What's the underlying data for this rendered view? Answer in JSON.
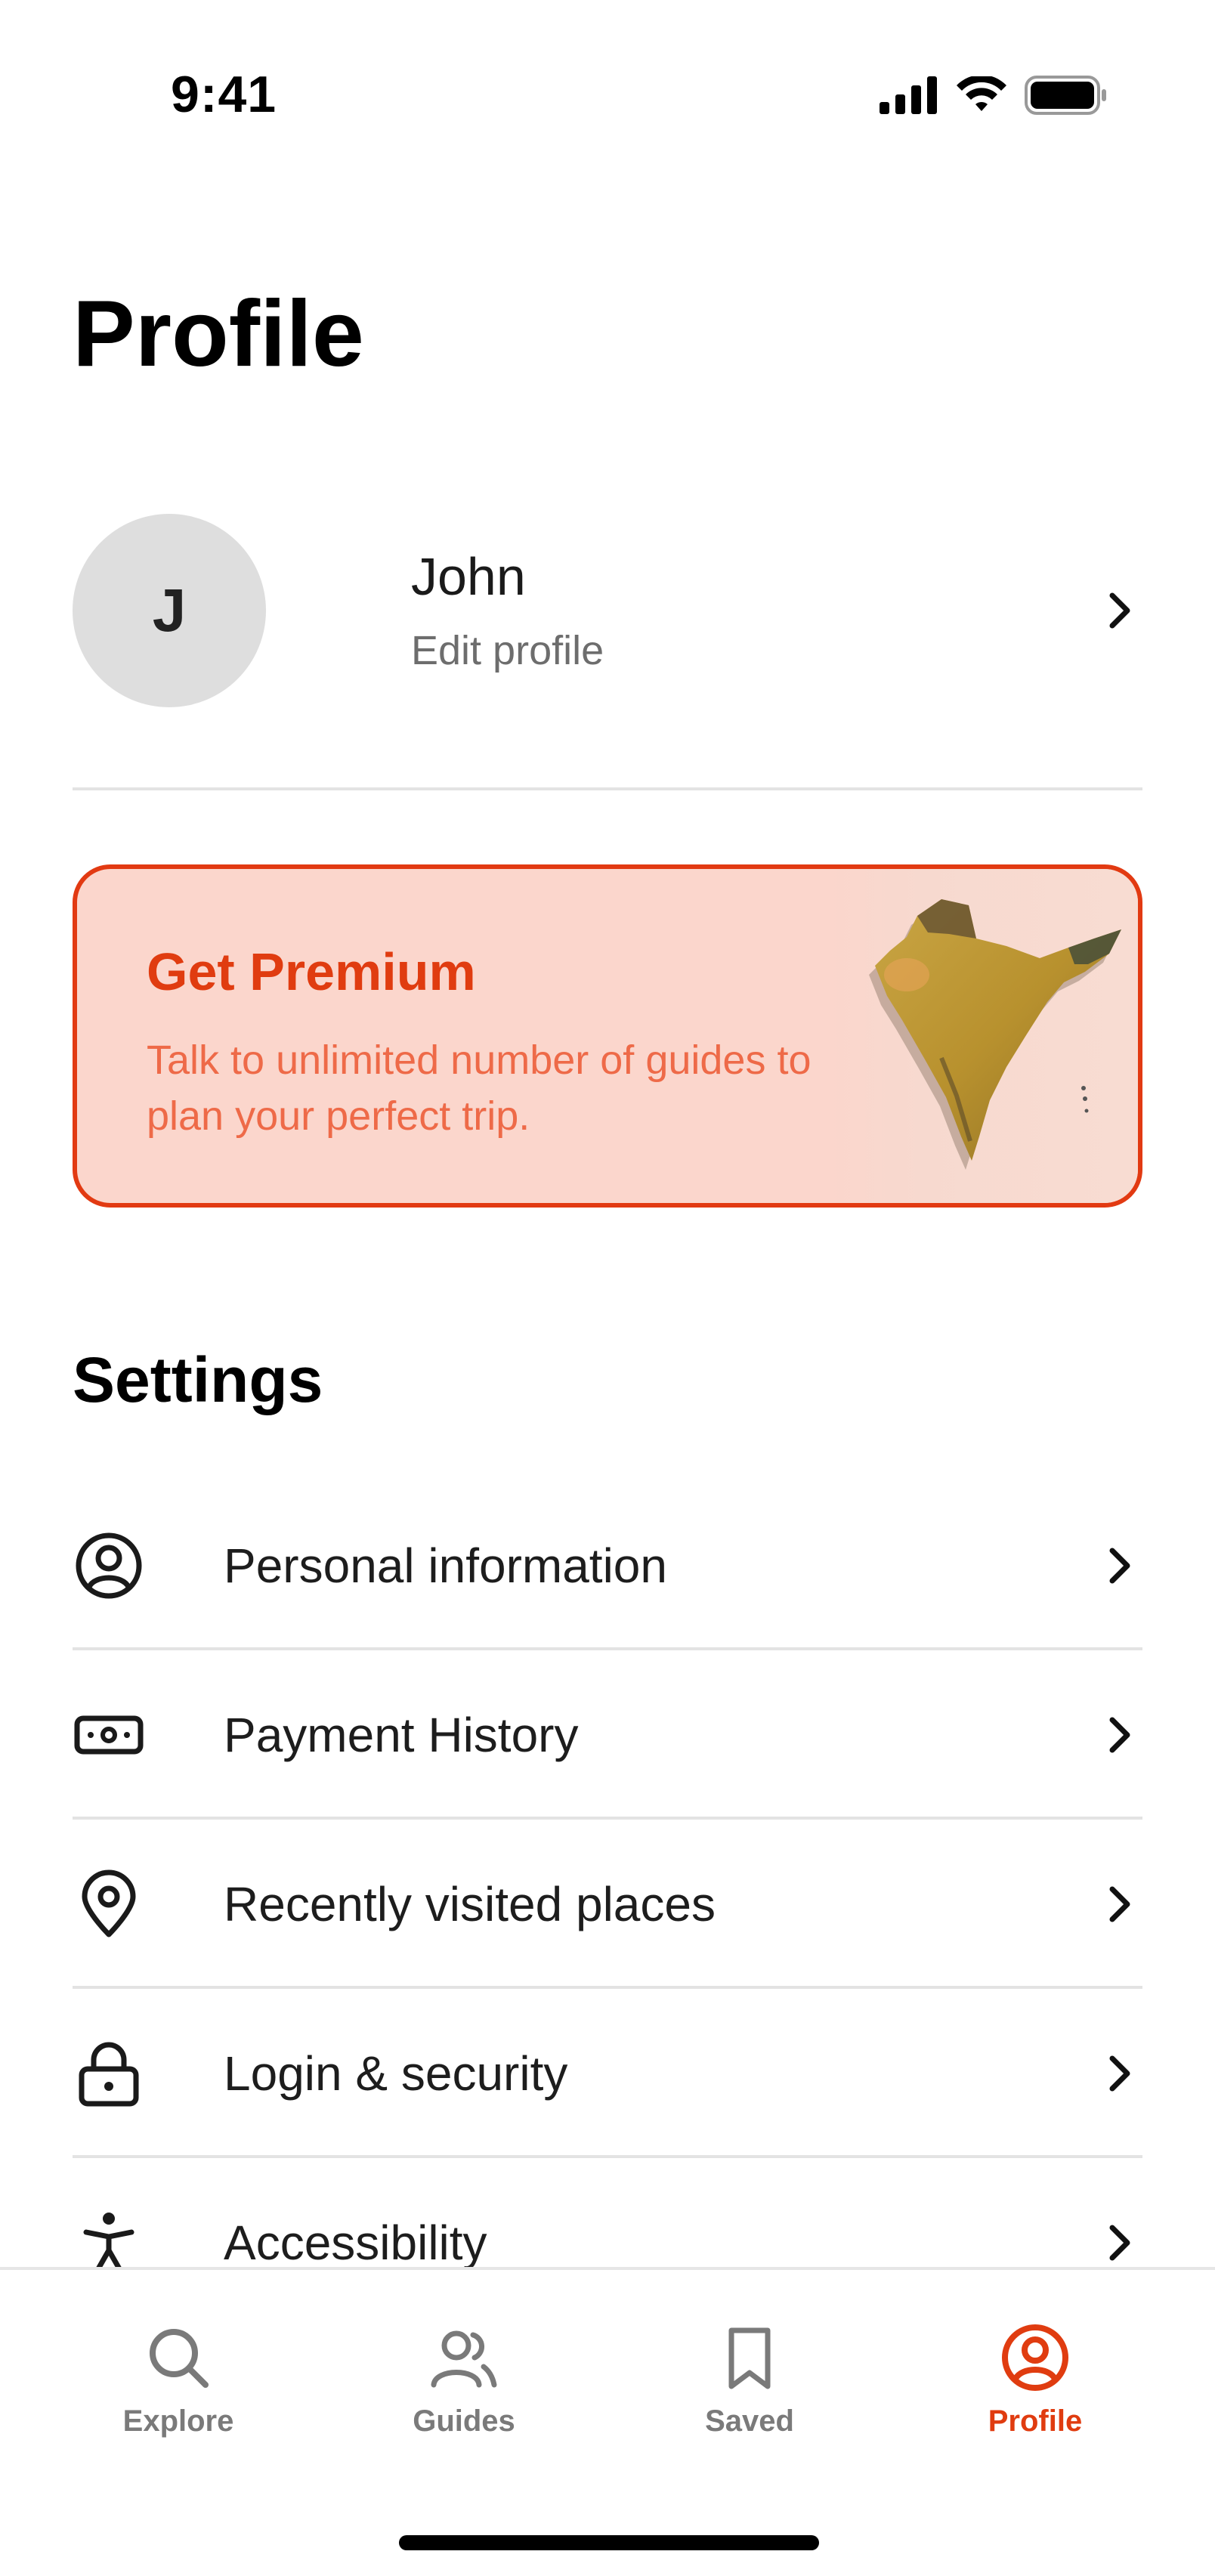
{
  "status_bar": {
    "time": "9:41"
  },
  "page": {
    "title": "Profile"
  },
  "profile": {
    "initial": "J",
    "name": "John",
    "subtitle": "Edit profile"
  },
  "premium": {
    "title": "Get Premium",
    "description": "Talk to unlimited number of guides to plan your perfect trip.",
    "accent_color": "#e03c10",
    "background_color": "#fbd6cc"
  },
  "settings": {
    "title": "Settings",
    "items": [
      {
        "label": "Personal information",
        "icon": "user-circle-icon"
      },
      {
        "label": "Payment History",
        "icon": "cash-icon"
      },
      {
        "label": "Recently visited places",
        "icon": "location-pin-icon"
      },
      {
        "label": "Login & security",
        "icon": "lock-icon"
      },
      {
        "label": "Accessibility",
        "icon": "accessibility-icon"
      }
    ]
  },
  "tab_bar": {
    "tabs": [
      {
        "label": "Explore",
        "icon": "search-icon",
        "active": false
      },
      {
        "label": "Guides",
        "icon": "users-icon",
        "active": false
      },
      {
        "label": "Saved",
        "icon": "bookmark-icon",
        "active": false
      },
      {
        "label": "Profile",
        "icon": "user-circle-icon",
        "active": true
      }
    ],
    "active_color": "#e03c10",
    "inactive_color": "#7a7a7a"
  }
}
